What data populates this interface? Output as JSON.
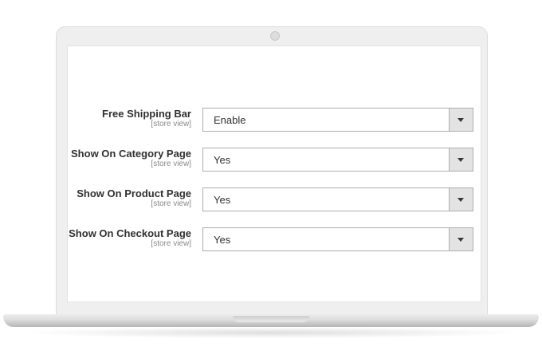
{
  "form": {
    "fields": [
      {
        "label": "Free Shipping Bar",
        "scope": "[store view]",
        "value": "Enable"
      },
      {
        "label": "Show On Category Page",
        "scope": "[store view]",
        "value": "Yes"
      },
      {
        "label": "Show On Product Page",
        "scope": "[store view]",
        "value": "Yes"
      },
      {
        "label": "Show On Checkout Page",
        "scope": "[store view]",
        "value": "Yes"
      }
    ]
  },
  "icons": {
    "dropdown": "chevron-down-icon"
  }
}
